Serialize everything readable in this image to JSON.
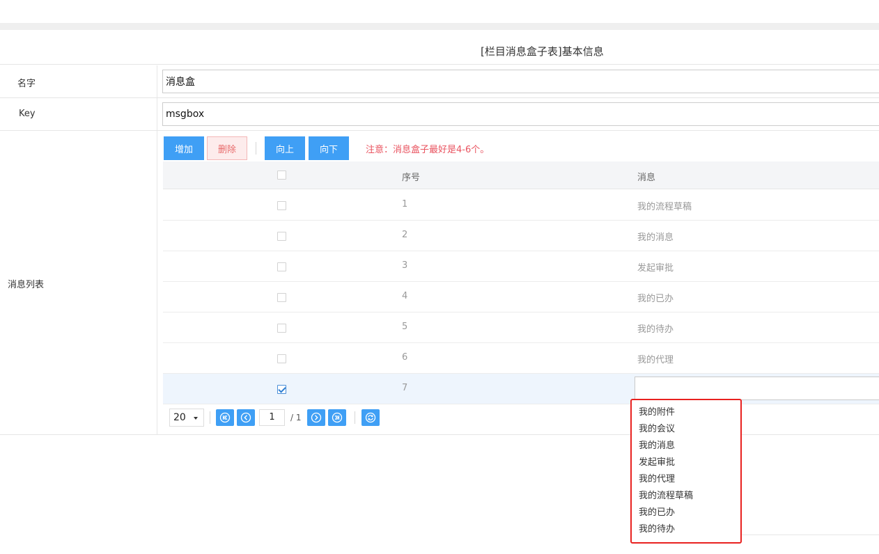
{
  "form": {
    "title": "[栏目消息盒子表]基本信息",
    "name_label": "名字",
    "name_value": "消息盒",
    "key_label": "Key",
    "key_value": "msgbox",
    "list_label": "消息列表"
  },
  "toolbar": {
    "add_label": "增加",
    "delete_label": "删除",
    "up_label": "向上",
    "down_label": "向下",
    "note": "注意：消息盒子最好是4-6个。"
  },
  "grid": {
    "columns": [
      "序号",
      "消息"
    ],
    "rows": [
      {
        "index": "1",
        "message": "我的流程草稿",
        "checked": false
      },
      {
        "index": "2",
        "message": "我的消息",
        "checked": false
      },
      {
        "index": "3",
        "message": "发起审批",
        "checked": false
      },
      {
        "index": "4",
        "message": "我的已办",
        "checked": false
      },
      {
        "index": "5",
        "message": "我的待办",
        "checked": false
      },
      {
        "index": "6",
        "message": "我的代理",
        "checked": false
      },
      {
        "index": "7",
        "message": "",
        "checked": true
      }
    ]
  },
  "pager": {
    "page_size": "20",
    "current_page": "1",
    "total_text": "/ 1"
  },
  "dropdown": {
    "options": [
      "我的附件",
      "我的会议",
      "我的消息",
      "发起审批",
      "我的代理",
      "我的流程草稿",
      "我的已办",
      "我的待办"
    ]
  },
  "colors": {
    "primary": "#3f9ff5",
    "danger_text": "#e9535f",
    "highlight_border": "#e8211f",
    "selected_row": "#eef5fd"
  },
  "icons": {
    "first_page": "first-page-icon",
    "prev_page": "prev-page-icon",
    "next_page": "next-page-icon",
    "last_page": "last-page-icon",
    "refresh": "refresh-icon"
  }
}
